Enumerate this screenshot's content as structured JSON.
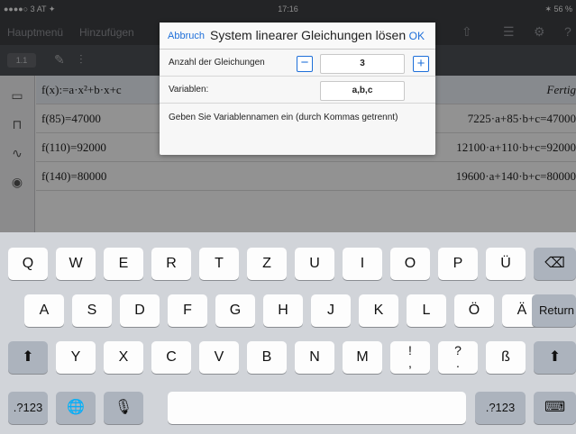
{
  "status": {
    "carrier": "●●●●○ 3 AT ✦",
    "time": "17:16",
    "battery": "✶ 56 %"
  },
  "menubar": {
    "items": [
      "Hauptmenü",
      "Hinzufügen"
    ],
    "page": "1.1"
  },
  "sidebar_icons": [
    "document-icon",
    "book-icon",
    "graph-icon",
    "camera-icon"
  ],
  "rows": [
    {
      "cmd": "f(x):=a·x²+b·x+c",
      "res": "Fertig"
    },
    {
      "cmd": "f(85)=47000",
      "res": "7225·a+85·b+c=47000"
    },
    {
      "cmd": "f(110)=92000",
      "res": "12100·a+110·b+c=92000"
    },
    {
      "cmd": "f(140)=80000",
      "res": "19600·a+140·b+c=80000"
    }
  ],
  "dialog": {
    "cancel": "Abbruch",
    "title": "System linearer Gleichungen lösen",
    "ok": "OK",
    "eq_label": "Anzahl der Gleichungen",
    "eq_value": "3",
    "minus": "−",
    "plus": "+",
    "var_label": "Variablen:",
    "var_value": "a,b,c",
    "hint": "Geben Sie Variablennamen ein (durch Kommas getrennt)"
  },
  "keyboard": {
    "row1": [
      "Q",
      "W",
      "E",
      "R",
      "T",
      "Z",
      "U",
      "I",
      "O",
      "P",
      "Ü"
    ],
    "row1_delete": "⌫",
    "row2": [
      "A",
      "S",
      "D",
      "F",
      "G",
      "H",
      "J",
      "K",
      "L",
      "Ö",
      "Ä"
    ],
    "return": "Return",
    "shift": "⬆",
    "row3": [
      "Y",
      "X",
      "C",
      "V",
      "B",
      "N",
      "M"
    ],
    "row3_punct": [
      [
        "!",
        ","
      ],
      [
        "?",
        "."
      ]
    ],
    "eszett": "ß",
    "numbers": ".?123",
    "globe": "🌐",
    "mic": "🎙",
    "hide": "⌨"
  }
}
